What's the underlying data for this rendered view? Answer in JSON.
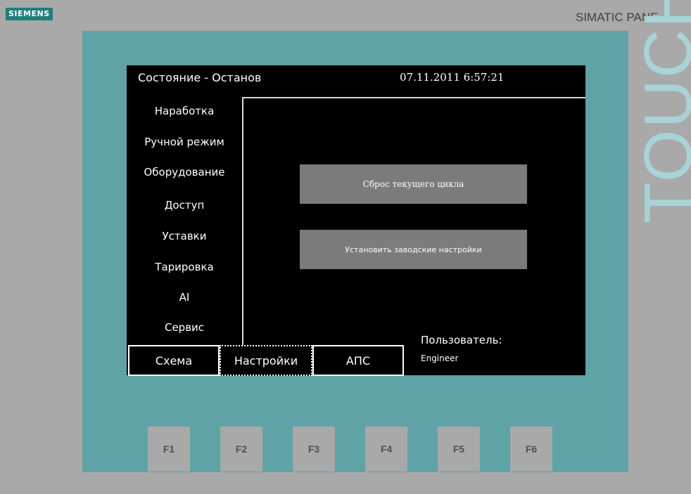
{
  "device": {
    "brand": "SIEMENS",
    "model": "SIMATIC PANE",
    "series": "TOUCH"
  },
  "header": {
    "status": "Состояние - Останов",
    "datetime": "07.11.2011 6:57:21"
  },
  "menu": [
    "Наработка",
    "Ручной режим",
    "Оборудование",
    "Доступ",
    "Уставки",
    "Тарировка",
    "AI",
    "Сервис"
  ],
  "buttons": {
    "reset_cycle": "Сброс текущего цикла",
    "factory_settings": "Установить заводские настройки"
  },
  "user": {
    "label": "Пользователь:",
    "name": "Engineer"
  },
  "tabs": [
    "Схема",
    "Настройки",
    "АПС"
  ],
  "active_tab": "Настройки",
  "function_keys": [
    "F1",
    "F2",
    "F3",
    "F4",
    "F5",
    "F6"
  ],
  "colors": {
    "bezel": "#a9a9a9",
    "frame": "#5fa3a6",
    "screen": "#000000",
    "button": "#7b7b7b"
  }
}
